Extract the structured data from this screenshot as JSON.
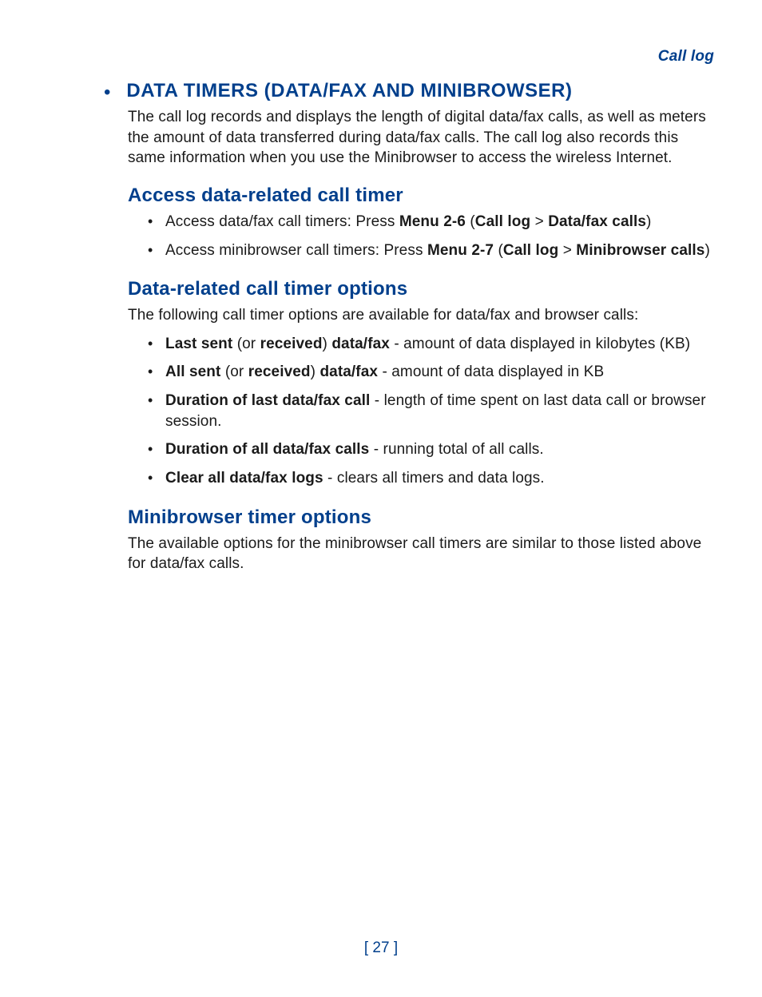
{
  "running_header": "Call log",
  "main_heading": "DATA TIMERS (DATA/FAX AND MINIBROWSER)",
  "intro_para": "The call log records and displays the length of digital data/fax calls, as well as meters the amount of data transferred during data/fax calls. The call log also records this same information when you use the Minibrowser to access the wireless Internet.",
  "section1": {
    "heading": "Access data-related call timer",
    "items": [
      {
        "pre": "Access data/fax call timers: Press ",
        "b1": "Menu 2-6",
        "mid1": " (",
        "b2": "Call log",
        "mid2": " > ",
        "b3": "Data/fax calls",
        "post": ")"
      },
      {
        "pre": "Access minibrowser call timers: Press ",
        "b1": "Menu 2-7",
        "mid1": " (",
        "b2": "Call log",
        "mid2": " > ",
        "b3": "Minibrowser calls",
        "post": ")"
      }
    ]
  },
  "section2": {
    "heading": "Data-related call timer options",
    "intro": "The following call timer options are available for data/fax and browser calls:",
    "items": [
      {
        "b1": "Last sent",
        "t1": " (or ",
        "b2": "received",
        "t2": ") ",
        "b3": "data/fax",
        "t3": " - amount of data displayed in kilobytes (KB)"
      },
      {
        "b1": "All sent",
        "t1": " (or ",
        "b2": "received",
        "t2": ") ",
        "b3": "data/fax",
        "t3": " - amount of data displayed in KB"
      },
      {
        "b1": "Duration of last data/fax call",
        "t1": " - length of time spent on last data call or browser session.",
        "b2": "",
        "t2": "",
        "b3": "",
        "t3": ""
      },
      {
        "b1": "Duration of all data/fax calls",
        "t1": " - running total of all calls.",
        "b2": "",
        "t2": "",
        "b3": "",
        "t3": ""
      },
      {
        "b1": "Clear all data/fax logs",
        "t1": " - clears all timers and data logs.",
        "b2": "",
        "t2": "",
        "b3": "",
        "t3": ""
      }
    ]
  },
  "section3": {
    "heading": "Minibrowser timer options",
    "para": "The available options for the minibrowser call timers are similar to those listed above for data/fax calls."
  },
  "page_number": "[ 27 ]"
}
